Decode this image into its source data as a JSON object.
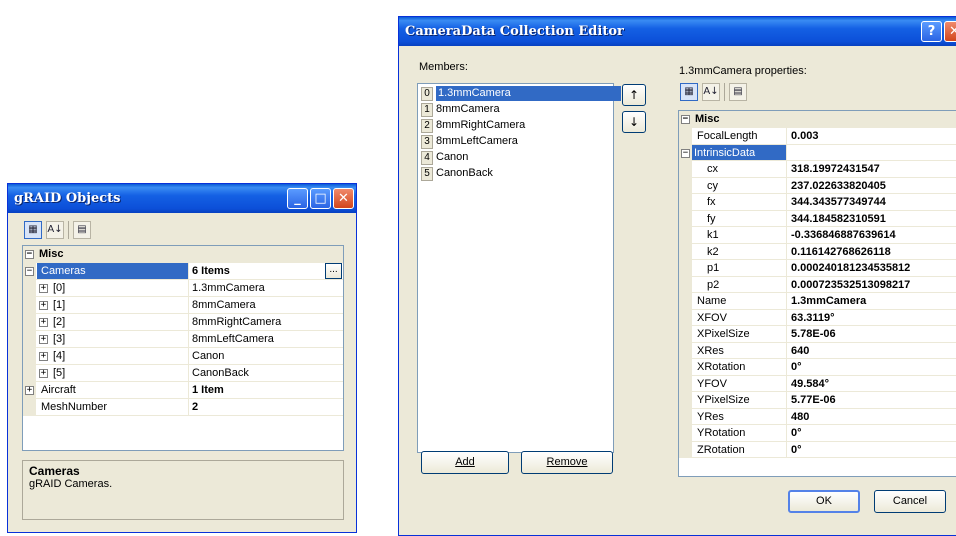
{
  "left_window": {
    "title": "gRAID Objects",
    "description_title": "Cameras",
    "description_text": "gRAID Cameras.",
    "category": "Misc",
    "rows": [
      {
        "name": "Cameras",
        "value": "6 Items"
      },
      {
        "name": "[0]",
        "value": "1.3mmCamera"
      },
      {
        "name": "[1]",
        "value": "8mmCamera"
      },
      {
        "name": "[2]",
        "value": "8mmRightCamera"
      },
      {
        "name": "[3]",
        "value": "8mmLeftCamera"
      },
      {
        "name": "[4]",
        "value": "Canon"
      },
      {
        "name": "[5]",
        "value": "CanonBack"
      },
      {
        "name": "Aircraft",
        "value": "1 Item"
      },
      {
        "name": "MeshNumber",
        "value": "2"
      }
    ],
    "ellipsis": "..."
  },
  "editor": {
    "title": "CameraData Collection Editor",
    "members_label": "Members:",
    "members": [
      {
        "index": "0",
        "name": "1.3mmCamera"
      },
      {
        "index": "1",
        "name": "8mmCamera"
      },
      {
        "index": "2",
        "name": "8mmRightCamera"
      },
      {
        "index": "3",
        "name": "8mmLeftCamera"
      },
      {
        "index": "4",
        "name": "Canon"
      },
      {
        "index": "5",
        "name": "CanonBack"
      }
    ],
    "add_label": "Add",
    "remove_label": "Remove",
    "properties_label": "1.3mmCamera properties:",
    "category": "Misc",
    "properties": [
      {
        "name": "FocalLength",
        "value": "0.003"
      },
      {
        "name": "IntrinsicData",
        "value": ""
      },
      {
        "name": "cx",
        "value": "318.19972431547"
      },
      {
        "name": "cy",
        "value": "237.022633820405"
      },
      {
        "name": "fx",
        "value": "344.343577349744"
      },
      {
        "name": "fy",
        "value": "344.184582310591"
      },
      {
        "name": "k1",
        "value": "-0.336846887639614"
      },
      {
        "name": "k2",
        "value": "0.116142768626118"
      },
      {
        "name": "p1",
        "value": "0.000240181234535812"
      },
      {
        "name": "p2",
        "value": "0.000723532513098217"
      },
      {
        "name": "Name",
        "value": "1.3mmCamera"
      },
      {
        "name": "XFOV",
        "value": "63.3119°"
      },
      {
        "name": "XPixelSize",
        "value": "5.78E-06"
      },
      {
        "name": "XRes",
        "value": "640"
      },
      {
        "name": "XRotation",
        "value": "0°"
      },
      {
        "name": "YFOV",
        "value": "49.584°"
      },
      {
        "name": "YPixelSize",
        "value": "5.77E-06"
      },
      {
        "name": "YRes",
        "value": "480"
      },
      {
        "name": "YRotation",
        "value": "0°"
      },
      {
        "name": "ZRotation",
        "value": "0°"
      }
    ],
    "ok_label": "OK",
    "cancel_label": "Cancel",
    "help_glyph": "?",
    "close_glyph": "✕"
  },
  "icons": {
    "categorized": "categorized-icon",
    "alphabetical": "alphabetical-sort-icon",
    "property_pages": "property-pages-icon",
    "up": "↑",
    "down": "↓",
    "sort_glyph": "A↓",
    "expand": "+",
    "collapse": "−"
  }
}
